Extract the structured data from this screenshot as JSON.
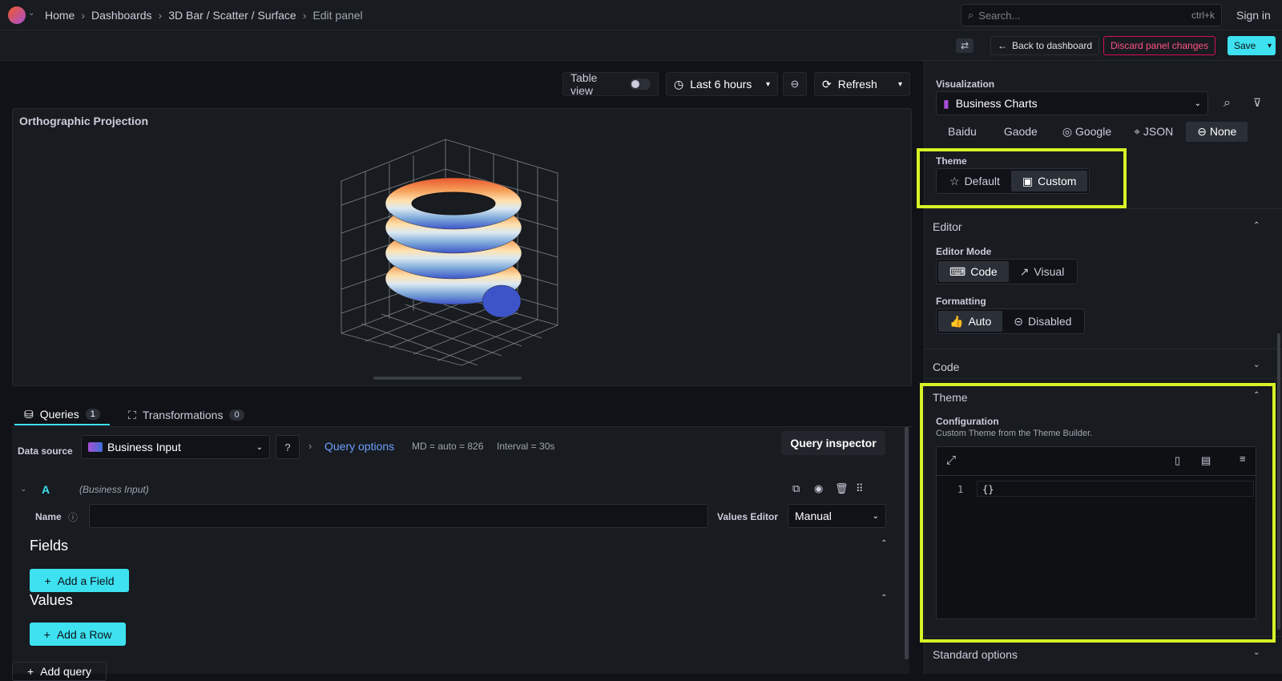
{
  "breadcrumbs": [
    "Home",
    "Dashboards",
    "3D Bar / Scatter / Surface",
    "Edit panel"
  ],
  "search": {
    "placeholder": "Search...",
    "shortcut": "ctrl+k"
  },
  "signin": "Sign in",
  "toolbar": {
    "back": "Back to dashboard",
    "discard": "Discard panel changes",
    "save": "Save"
  },
  "time": {
    "table_view": "Table view",
    "range": "Last 6 hours",
    "refresh": "Refresh"
  },
  "panel": {
    "title": "Orthographic Projection"
  },
  "tabs": [
    {
      "label": "Queries",
      "count": "1"
    },
    {
      "label": "Transformations",
      "count": "0"
    }
  ],
  "query": {
    "ds_label": "Data source",
    "ds_value": "Business Input",
    "options": "Query options",
    "md": "MD = auto = 826",
    "interval": "Interval = 30s",
    "inspector": "Query inspector",
    "ref": "A",
    "ref_ds": "(Business Input)",
    "name_label": "Name",
    "values_editor_label": "Values Editor",
    "values_editor_value": "Manual",
    "fields": "Fields",
    "add_field": "Add a Field",
    "values": "Values",
    "add_row": "Add a Row",
    "add_query": "Add query"
  },
  "viz": {
    "label": "Visualization",
    "value": "Business Charts",
    "maps": [
      "Baidu",
      "Gaode",
      "Google",
      "JSON",
      "None"
    ],
    "theme_label": "Theme",
    "theme_opts": [
      "Default",
      "Custom"
    ],
    "editor": "Editor",
    "editor_mode": "Editor Mode",
    "modes": [
      "Code",
      "Visual"
    ],
    "formatting": "Formatting",
    "fmt": [
      "Auto",
      "Disabled"
    ],
    "code": "Code",
    "theme_sect": "Theme",
    "config": "Configuration",
    "config_desc": "Custom Theme from the Theme Builder.",
    "line_no": "1",
    "line": "{}",
    "standard": "Standard options"
  }
}
